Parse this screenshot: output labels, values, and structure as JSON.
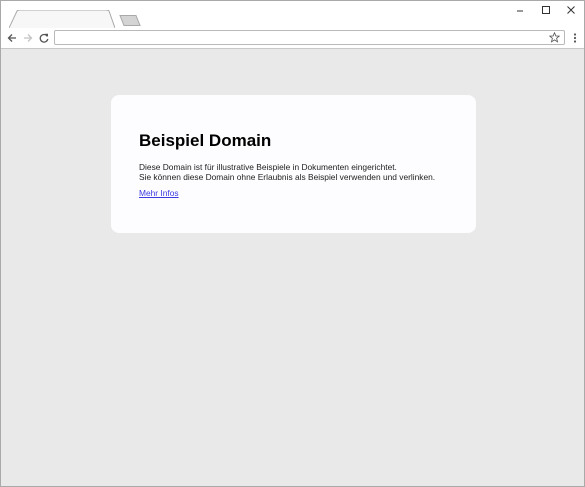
{
  "window": {
    "controls": [
      "minimize",
      "maximize",
      "close"
    ],
    "minimize_icon": "minimize-icon",
    "maximize_icon": "maximize-icon",
    "close_icon": "close-icon"
  },
  "tabs": [
    {
      "label": "",
      "active": true
    },
    {
      "label": "",
      "type": "new-tab"
    }
  ],
  "toolbar": {
    "back_icon": "arrow-left-icon",
    "forward_icon": "arrow-right-icon",
    "reload_icon": "reload-icon",
    "address_value": "",
    "bookmark_icon": "star-icon",
    "menu_icon": "kebab-menu-icon"
  },
  "page": {
    "heading": "Beispiel Domain",
    "paragraph_1": "Diese Domain ist für illustrative Beispiele in Dokumenten eingerichtet.",
    "paragraph_2": "Sie können diese Domain ohne Erlaubnis als Beispiel verwenden und verlinken.",
    "link_text": "Mehr Infos"
  },
  "colors": {
    "page_background": "#e9e9e9",
    "card_background": "#fdfdff",
    "link": "#3a3ae0",
    "chrome": "#ffffff"
  }
}
